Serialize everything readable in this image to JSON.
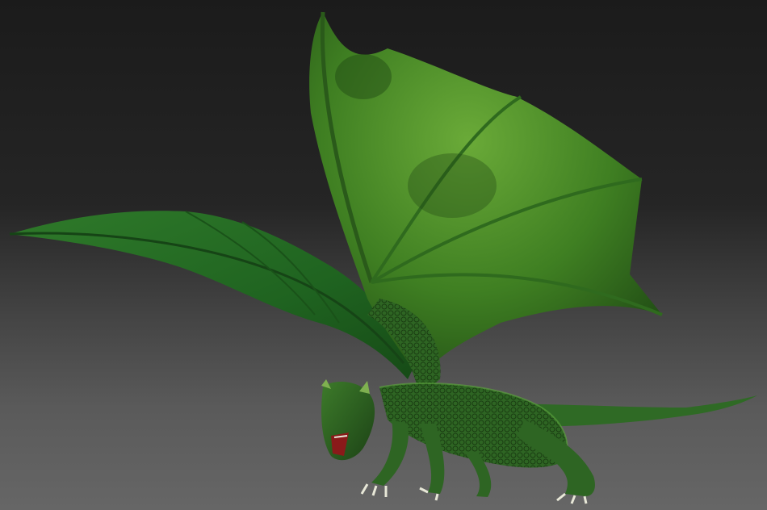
{
  "scene": {
    "subject": "dragon-model",
    "colors": {
      "background_top": "#1b1b1b",
      "background_bottom": "#666666",
      "body_green": "#2f6b26",
      "wing_green": "#4f9a2a",
      "wing_dark": "#1f4d16",
      "mouth_red": "#8a1a1a",
      "claw_white": "#e8e8d8"
    }
  }
}
